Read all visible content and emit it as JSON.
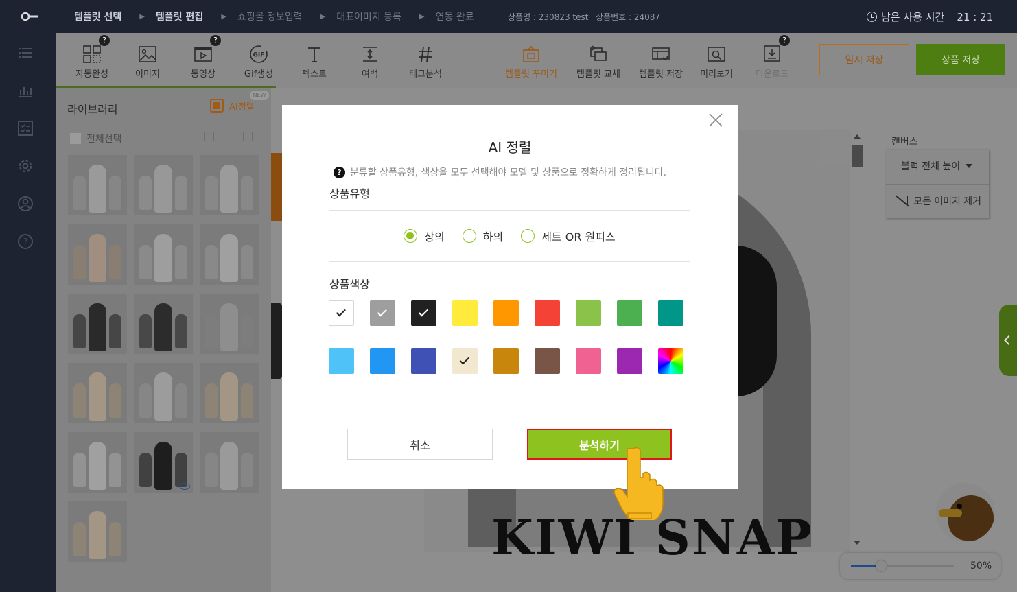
{
  "topbar": {
    "steps": [
      {
        "label": "템플릿 선택",
        "active": true
      },
      {
        "label": "템플릿 편집",
        "active": true
      },
      {
        "label": "쇼핑몰 정보입력",
        "active": false
      },
      {
        "label": "대표이미지 등록",
        "active": false
      },
      {
        "label": "연동 완료",
        "active": false
      }
    ],
    "product_name": "상품명 : 230823 test",
    "product_no": "상품번호 : 24087",
    "time_label": "남은 사용 시간",
    "time_value": "21 : 21"
  },
  "rail": {
    "icons": [
      "list-icon",
      "chart-icon",
      "checklist-icon",
      "gear-icon",
      "user-icon",
      "help-icon"
    ]
  },
  "toolbar": {
    "tools": [
      {
        "label": "자동완성",
        "icon": "grid-icon",
        "help": "?"
      },
      {
        "label": "이미지",
        "icon": "image-icon"
      },
      {
        "label": "동영상",
        "icon": "video-icon",
        "help": "?"
      },
      {
        "label": "Gif생성",
        "icon": "gif-icon",
        "gif_text": "GIF"
      },
      {
        "label": "텍스트",
        "icon": "text-icon"
      },
      {
        "label": "여백",
        "icon": "spacing-icon"
      },
      {
        "label": "태그분석",
        "icon": "hashtag-icon"
      },
      {
        "label": "템플릿 꾸미기",
        "icon": "decorate-icon"
      },
      {
        "label": "템플릿 교체",
        "icon": "swap-icon"
      },
      {
        "label": "템플릿 저장",
        "icon": "template-save-icon"
      },
      {
        "label": "미리보기",
        "icon": "preview-icon"
      },
      {
        "label": "다운로드",
        "icon": "download-icon",
        "help": "?"
      }
    ],
    "temp_save": "임시 저장",
    "product_save": "상품 저장",
    "colors": {
      "accent_orange": "#e67e22",
      "accent_green": "#8ec31f"
    }
  },
  "library": {
    "title": "라이브러리",
    "ai_sort": "AI정렬",
    "ai_badge": "NEW",
    "select_all": "전체선택",
    "thumbnail_count": 16
  },
  "canvas": {
    "brand_text": "KIWI SNAP",
    "panel_title": "캔버스",
    "block_height": "블럭 전체 높이",
    "remove_images": "모든 이미지 제거",
    "zoom": "50%"
  },
  "modal": {
    "title": "AI 정렬",
    "notice": "분류할 상품유형, 색상을 모두 선택해야 모델 및 상품으로 정확하게 정리됩니다.",
    "type_label": "상품유형",
    "types": [
      {
        "label": "상의",
        "selected": true
      },
      {
        "label": "하의",
        "selected": false
      },
      {
        "label": "세트 OR 원피스",
        "selected": false
      }
    ],
    "color_label": "상품색상",
    "colors": [
      {
        "hex": "#ffffff",
        "checked": true
      },
      {
        "hex": "#9e9e9e",
        "checked": true
      },
      {
        "hex": "#212121",
        "checked": true
      },
      {
        "hex": "#ffeb3b",
        "checked": false
      },
      {
        "hex": "#ff9800",
        "checked": false
      },
      {
        "hex": "#f44336",
        "checked": false
      },
      {
        "hex": "#8bc34a",
        "checked": false
      },
      {
        "hex": "#4caf50",
        "checked": false
      },
      {
        "hex": "#009688",
        "checked": false
      },
      {
        "hex": "#4fc3f7",
        "checked": false
      },
      {
        "hex": "#2196f3",
        "checked": false
      },
      {
        "hex": "#3f51b5",
        "checked": false
      },
      {
        "hex": "#f2e8cf",
        "checked": true
      },
      {
        "hex": "#c8860d",
        "checked": false
      },
      {
        "hex": "#795548",
        "checked": false
      },
      {
        "hex": "#f06292",
        "checked": false
      },
      {
        "hex": "#9c27b0",
        "checked": false
      },
      {
        "hex": "rainbow",
        "checked": false
      }
    ],
    "cancel": "취소",
    "analyze": "분석하기"
  }
}
